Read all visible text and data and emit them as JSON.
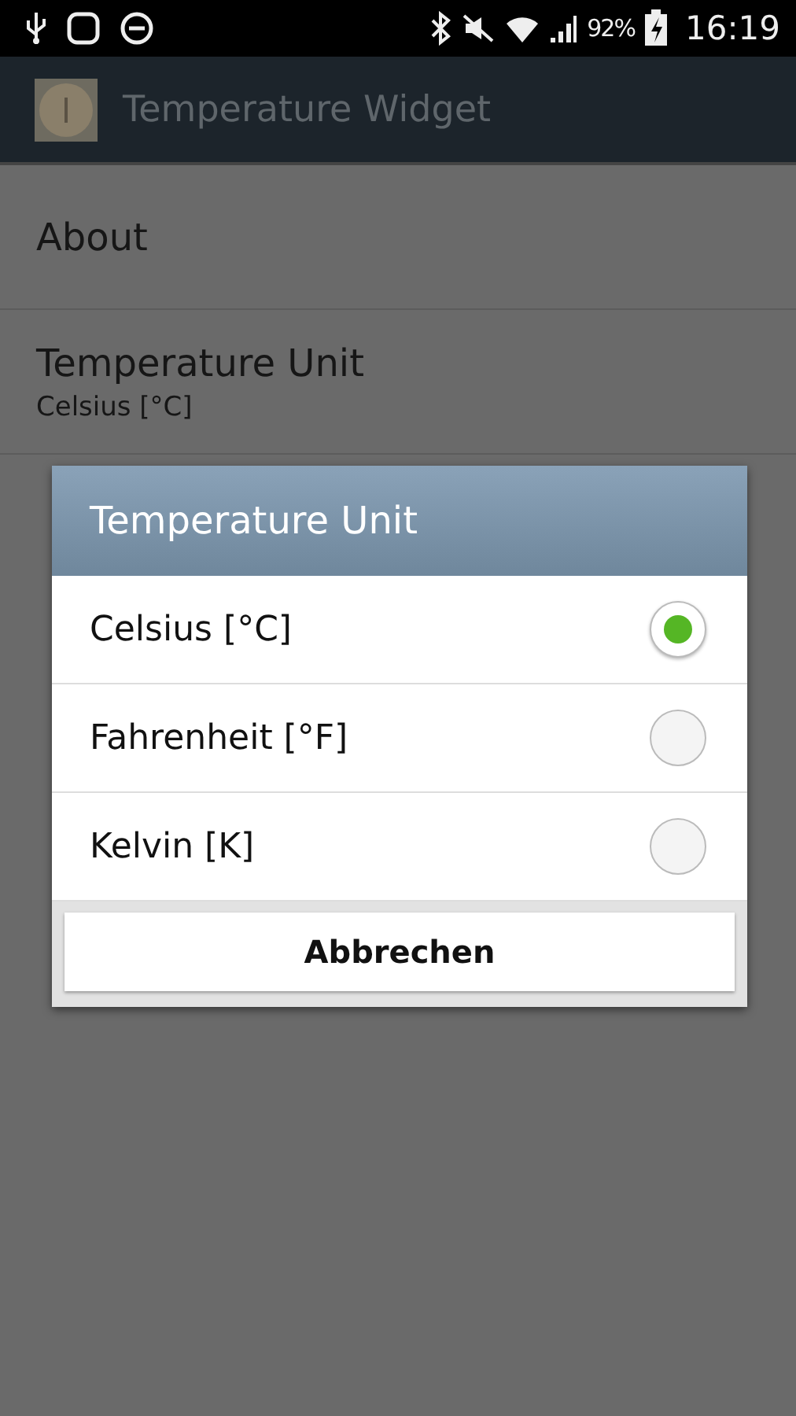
{
  "status_bar": {
    "battery": "92%",
    "time": "16:19"
  },
  "app_bar": {
    "title": "Temperature Widget"
  },
  "settings": [
    {
      "title": "About"
    },
    {
      "title": "Temperature Unit",
      "summary": "Celsius [°C]"
    }
  ],
  "dialog": {
    "title": "Temperature Unit",
    "options": [
      {
        "label": "Celsius [°C]",
        "selected": true
      },
      {
        "label": "Fahrenheit [°F]",
        "selected": false
      },
      {
        "label": "Kelvin [K]",
        "selected": false
      }
    ],
    "cancel_button": "Abbrechen"
  }
}
